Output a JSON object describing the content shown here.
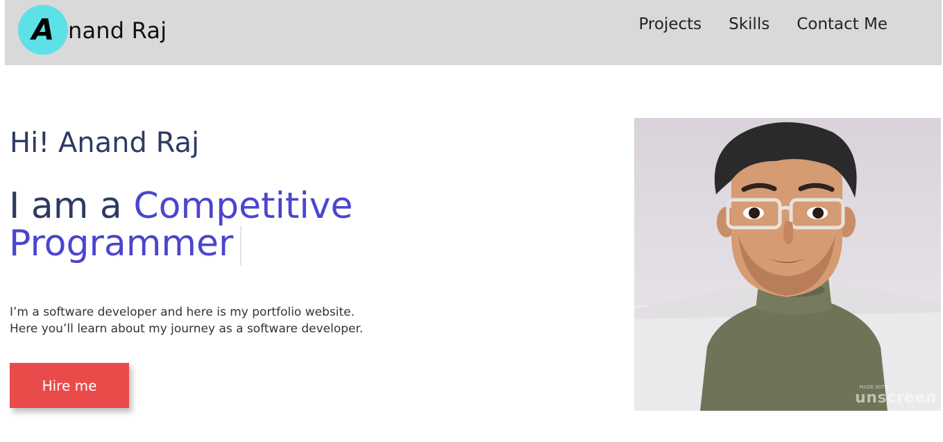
{
  "header": {
    "logo_letter": "A",
    "logo_rest": "nand Raj",
    "nav": [
      "Projects",
      "Skills",
      "Contact Me"
    ]
  },
  "hero": {
    "greeting": "Hi! Anand Raj",
    "headline_prefix": "I am a ",
    "headline_role": "Competitive Programmer",
    "intro_line1": "I’m a software developer and here is my portfolio website.",
    "intro_line2": "Here you’ll learn about my journey as a software developer.",
    "cta_label": "Hire me"
  },
  "avatar": {
    "watermark": "unscreen",
    "watermark_small": "MADE WITH"
  },
  "colors": {
    "header_bg": "#d9d9d9",
    "logo_circle": "#5ce1e6",
    "heading_text": "#2f3a63",
    "accent_role": "#4b45cf",
    "cta_bg": "#e94b4b"
  }
}
